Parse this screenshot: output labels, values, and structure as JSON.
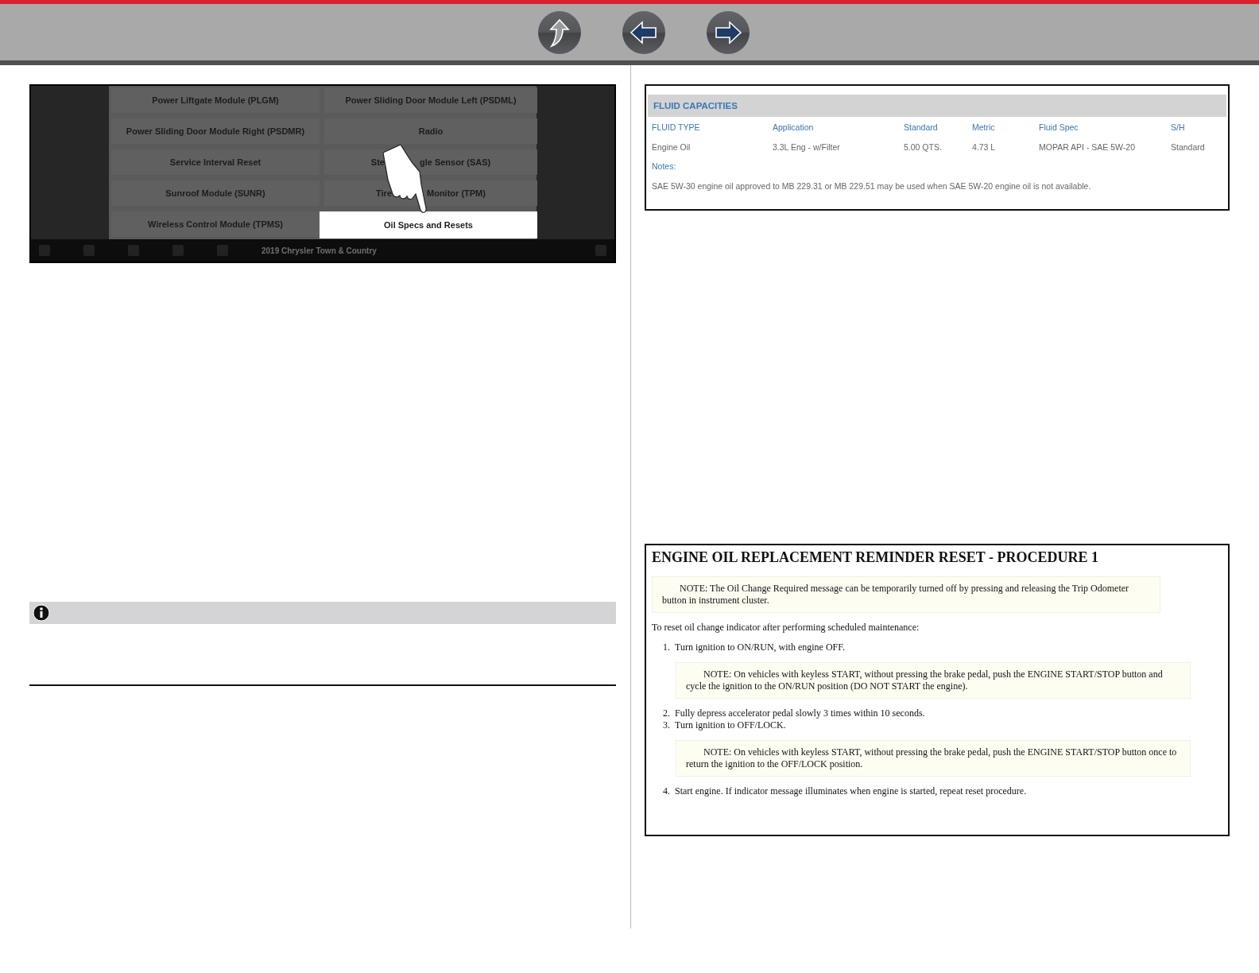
{
  "nav_buttons": [
    {
      "kind": "up"
    },
    {
      "kind": "back"
    },
    {
      "kind": "forward"
    }
  ],
  "app_menu": {
    "buttons": [
      {
        "label_parts": [
          "Power Liftgate Module (PLGM)"
        ],
        "selected": false
      },
      {
        "label_parts": [
          "Power Sliding Door Module Left (PSDML)"
        ],
        "selected": false
      },
      {
        "label_parts": [
          "Power Sliding Door Module Right (PSDMR)"
        ],
        "selected": false
      },
      {
        "label_parts": [
          "Radio"
        ],
        "selected": false
      },
      {
        "label_parts": [
          "Service Interval Reset"
        ],
        "selected": false
      },
      {
        "label_parts": [
          "Ste",
          "gle Sensor (SAS)"
        ],
        "selected": false
      },
      {
        "label_parts": [
          "Sunroof Module (SUNR)"
        ],
        "selected": false
      },
      {
        "label_parts": [
          "Tire",
          "Monitor (TPM)"
        ],
        "selected": false
      },
      {
        "label_parts": [
          "Wireless Control Module (TPMS)"
        ],
        "selected": false
      },
      {
        "label_parts": [
          "Oil Specs and Resets"
        ],
        "selected": true
      }
    ],
    "vehicle": "2019 Chrysler Town & Country"
  },
  "fluid_capacities": {
    "title": "FLUID CAPACITIES",
    "columns": [
      "FLUID TYPE",
      "Application",
      "Standard",
      "Metric",
      "Fluid Spec",
      "S/H"
    ],
    "rows": [
      [
        "Engine Oil",
        "3.3L Eng - w/Filter",
        "5.00 QTS.",
        "4.73 L",
        "MOPAR API - SAE 5W-20",
        "Standard"
      ]
    ],
    "notes_label": "Notes:",
    "note": "SAE 5W-30 engine oil approved to MB 229.31 or MB 229.51 may be used when SAE 5W-20 engine oil is not available."
  },
  "procedure": {
    "title": "ENGINE OIL REPLACEMENT REMINDER RESET - PROCEDURE 1",
    "note": "NOTE: The Oil Change Required message can be temporarily turned off by pressing and releasing the Trip Odometer button in instrument cluster.",
    "intro": "To reset oil change indicator after performing scheduled maintenance:",
    "steps": [
      {
        "number": "1.",
        "text": "Turn ignition to ON/RUN, with engine OFF.",
        "note": "NOTE: On vehicles with keyless START, without pressing the brake pedal, push the ENGINE START/STOP button and cycle the ignition to the ON/RUN position (DO NOT START the engine)."
      },
      {
        "number": "2.",
        "text": "Fully depress accelerator pedal slowly 3 times within 10 seconds."
      },
      {
        "number": "3.",
        "text": "Turn ignition to OFF/LOCK.",
        "note": "NOTE: On vehicles with keyless START, without pressing the brake pedal, push the ENGINE START/STOP button once to return the ignition to the OFF/LOCK position."
      },
      {
        "number": "4.",
        "text": "Start engine. If indicator message illuminates when engine is started, repeat reset procedure."
      }
    ]
  }
}
